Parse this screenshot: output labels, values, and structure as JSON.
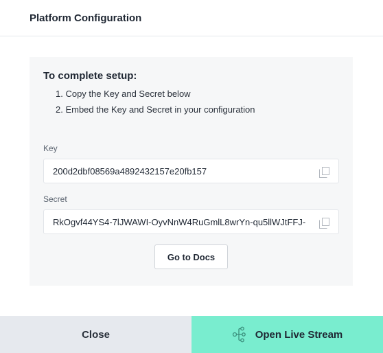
{
  "header": {
    "title": "Platform Configuration"
  },
  "setup": {
    "heading": "To complete setup:",
    "steps": [
      "1. Copy the Key and Secret below",
      "2. Embed the Key and Secret in your configuration"
    ]
  },
  "key": {
    "label": "Key",
    "value": "200d2dbf08569a4892432157e20fb157",
    "copy_icon": "copy-icon"
  },
  "secret": {
    "label": "Secret",
    "value": "RkOgvf44YS4-7lJWAWI-OyvNnW4RuGmlL8wrYn-qu5llWJtFFJ-",
    "copy_icon": "copy-icon"
  },
  "docs_button": {
    "label": "Go to Docs"
  },
  "footer": {
    "close_label": "Close",
    "stream_label": "Open Live Stream",
    "stream_icon": "live-stream-icon"
  },
  "colors": {
    "accent": "#79edcf",
    "close_bg": "#e6e9ee",
    "panel_bg": "#f6f7f8"
  }
}
